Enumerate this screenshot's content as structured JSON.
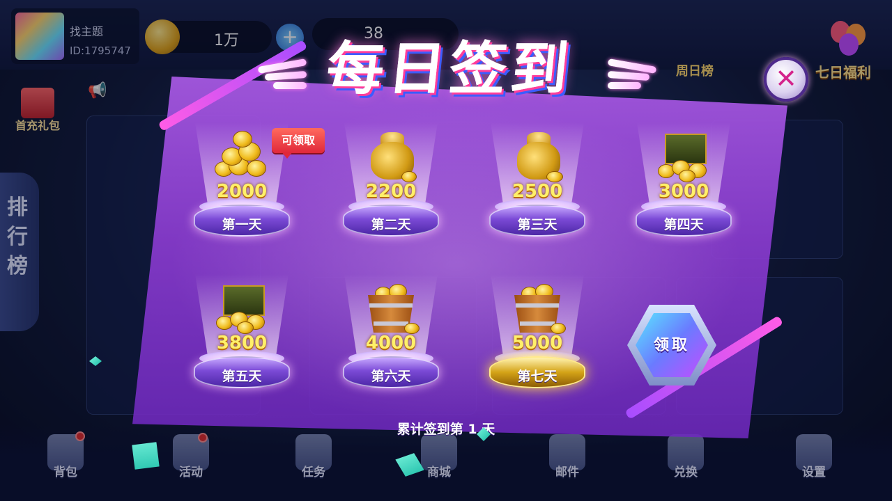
{
  "player": {
    "name": "找主题",
    "id": "ID:1795747"
  },
  "currency": {
    "coins": "1万",
    "gems": "38"
  },
  "top_right": {
    "weekly": "周日榜",
    "seven_day": "七日福利"
  },
  "side": {
    "first_recharge": "首充礼包",
    "rank": "排行榜"
  },
  "modal": {
    "title": "每日签到",
    "claim_badge": "可领取",
    "claim_button": "领取",
    "footer": "累计签到第 1 天",
    "days": [
      {
        "amount": "2000",
        "label": "第一天",
        "reward": "coin-pile-icon"
      },
      {
        "amount": "2200",
        "label": "第二天",
        "reward": "money-bag-icon"
      },
      {
        "amount": "2500",
        "label": "第三天",
        "reward": "money-bag-icon"
      },
      {
        "amount": "3000",
        "label": "第四天",
        "reward": "treasure-chest-icon"
      },
      {
        "amount": "3800",
        "label": "第五天",
        "reward": "treasure-chest-icon"
      },
      {
        "amount": "4000",
        "label": "第六天",
        "reward": "coin-bucket-icon"
      },
      {
        "amount": "5000",
        "label": "第七天",
        "reward": "coin-bucket-icon"
      }
    ]
  },
  "dock": [
    {
      "label": "背包"
    },
    {
      "label": "活动"
    },
    {
      "label": "任务"
    },
    {
      "label": "商城"
    },
    {
      "label": "邮件"
    },
    {
      "label": "兑换"
    },
    {
      "label": "设置"
    }
  ],
  "colors": {
    "accent": "#a84dff",
    "gold": "#fff06a",
    "badge": "#e0283a"
  }
}
